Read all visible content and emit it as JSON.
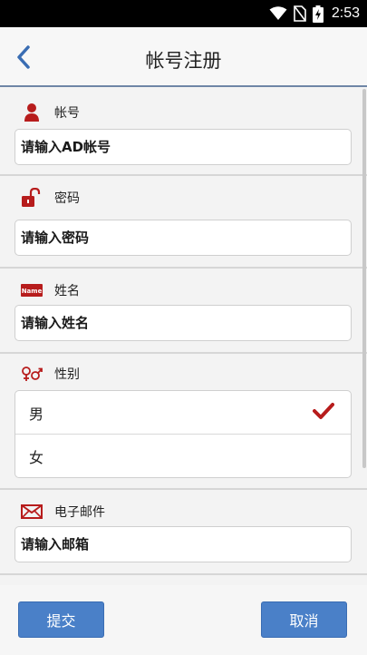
{
  "status_bar": {
    "time": "2:53",
    "icons": [
      "wifi-icon",
      "no-sim-icon",
      "battery-charging-icon"
    ]
  },
  "header": {
    "title": "帐号注册",
    "back_icon": "chevron-left-icon"
  },
  "colors": {
    "accent": "#4a80c8",
    "icon_red": "#b71c1c",
    "header_border": "#6f86a6",
    "check": "#b71c1c"
  },
  "form": {
    "account": {
      "label": "帐号",
      "icon": "user-icon",
      "placeholder": "请输入AD帐号",
      "value": ""
    },
    "password": {
      "label": "密码",
      "icon": "unlock-icon",
      "placeholder": "请输入密码",
      "value": ""
    },
    "name": {
      "label": "姓名",
      "icon": "name-tag-icon",
      "icon_text": "Name",
      "placeholder": "请输入姓名",
      "value": ""
    },
    "gender": {
      "label": "性别",
      "icon": "gender-icon",
      "options": [
        {
          "label": "男",
          "selected": true
        },
        {
          "label": "女",
          "selected": false
        }
      ]
    },
    "email": {
      "label": "电子邮件",
      "icon": "envelope-icon",
      "placeholder": "请输入邮箱",
      "value": ""
    }
  },
  "footer": {
    "submit_label": "提交",
    "cancel_label": "取消"
  }
}
